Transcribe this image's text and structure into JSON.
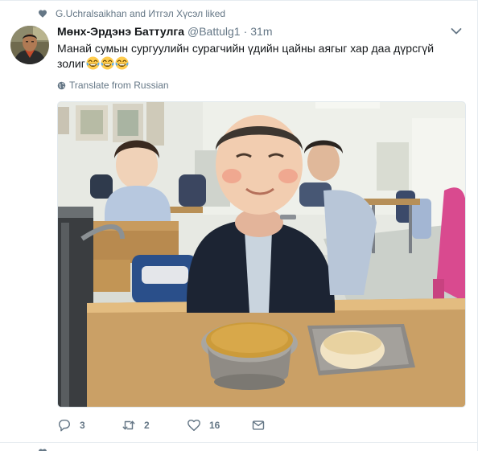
{
  "social_context": {
    "text": "G.Uchralsaikhan and Итгэл Хүсэл liked",
    "icon": "heart-icon"
  },
  "tweet": {
    "fullname": "Мөнх-Эрдэнэ Баттулга",
    "username": "@Battulg1",
    "separator": "·",
    "time": "31m",
    "text": "Манай сумын сургуулийн сурагчийн үдийн цайны аягыг хар даа дүрсгүй золиг",
    "emoji_count": 3,
    "emoji": "face-with-tears-of-joy",
    "translate_label": "Translate from Russian"
  },
  "actions": {
    "reply_count": "3",
    "retweet_count": "2",
    "like_count": "16"
  },
  "colors": {
    "link": "#1da1f2",
    "muted": "#657786",
    "text": "#14171a",
    "border": "#e6ecf0"
  }
}
